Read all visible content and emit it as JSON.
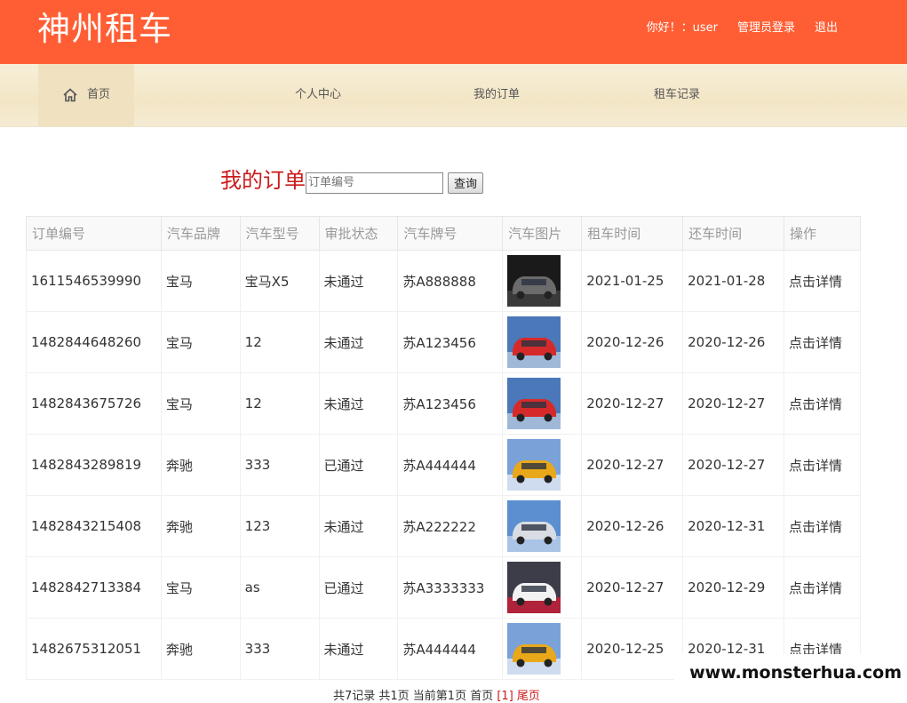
{
  "header": {
    "brand": "神州租车",
    "greeting": "你好！：user",
    "admin_login": "管理员登录",
    "logout": "退出"
  },
  "nav": {
    "home": "首页",
    "profile": "个人中心",
    "orders": "我的订单",
    "rentals": "租车记录"
  },
  "search": {
    "title": "我的订单",
    "placeholder": "订单编号",
    "button": "查询"
  },
  "table": {
    "headers": [
      "订单编号",
      "汽车品牌",
      "汽车型号",
      "审批状态",
      "汽车牌号",
      "汽车图片",
      "租车时间",
      "还车时间",
      "操作"
    ],
    "rows": [
      {
        "id": "1611546539990",
        "brand": "宝马",
        "model": "宝马X5",
        "status": "未通过",
        "plate": "苏A888888",
        "image": "black-car",
        "rent": "2021-01-25",
        "return": "2021-01-28",
        "action": "点击详情"
      },
      {
        "id": "1482844648260",
        "brand": "宝马",
        "model": "12",
        "status": "未通过",
        "plate": "苏A123456",
        "image": "red-car",
        "rent": "2020-12-26",
        "return": "2020-12-26",
        "action": "点击详情"
      },
      {
        "id": "1482843675726",
        "brand": "宝马",
        "model": "12",
        "status": "未通过",
        "plate": "苏A123456",
        "image": "red-car",
        "rent": "2020-12-27",
        "return": "2020-12-27",
        "action": "点击详情"
      },
      {
        "id": "1482843289819",
        "brand": "奔驰",
        "model": "333",
        "status": "已通过",
        "plate": "苏A444444",
        "image": "yellow-car",
        "rent": "2020-12-27",
        "return": "2020-12-27",
        "action": "点击详情"
      },
      {
        "id": "1482843215408",
        "brand": "奔驰",
        "model": "123",
        "status": "未通过",
        "plate": "苏A222222",
        "image": "silver-car",
        "rent": "2020-12-26",
        "return": "2020-12-31",
        "action": "点击详情"
      },
      {
        "id": "1482842713384",
        "brand": "宝马",
        "model": "as",
        "status": "已通过",
        "plate": "苏A3333333",
        "image": "white-car",
        "rent": "2020-12-27",
        "return": "2020-12-29",
        "action": "点击详情"
      },
      {
        "id": "1482675312051",
        "brand": "奔驰",
        "model": "333",
        "status": "未通过",
        "plate": "苏A444444",
        "image": "yellow-car",
        "rent": "2020-12-25",
        "return": "2020-12-31",
        "action": "点击详情"
      }
    ]
  },
  "pager": {
    "summary": "共7记录 共1页 当前第1页 首页",
    "current": "[1]",
    "last": "尾页"
  },
  "watermark": "www.monsterhua.com",
  "colors": {
    "header_bg": "#ff5e34",
    "nav_bg": "#f5ebd4",
    "accent_red": "#cc1a1a"
  }
}
